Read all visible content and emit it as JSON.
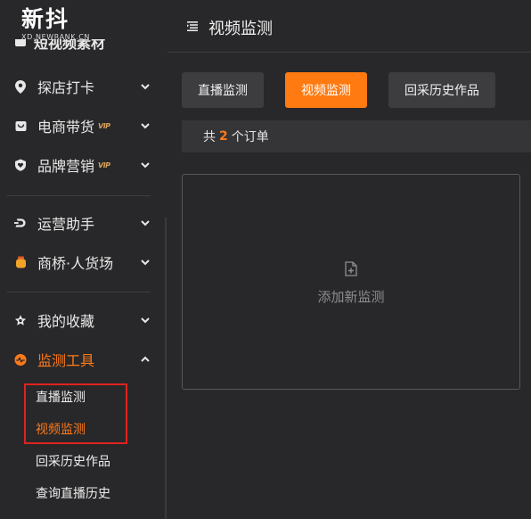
{
  "logo": {
    "main": "新抖",
    "sub": "XD.NEWRANK.CN"
  },
  "sidebar": {
    "cut_label": "短视频素材",
    "items": [
      {
        "label": "探店打卡",
        "icon": "location-pin-icon",
        "vip": ""
      },
      {
        "label": "电商带货",
        "icon": "shopping-bag-icon",
        "vip": "VIP"
      },
      {
        "label": "品牌营销",
        "icon": "heart-shield-icon",
        "vip": "VIP"
      },
      {
        "label": "运营助手",
        "icon": "d-logo-icon",
        "vip": ""
      },
      {
        "label": "商桥·人货场",
        "icon": "honey-jar-icon",
        "vip": ""
      },
      {
        "label": "我的收藏",
        "icon": "star-badge-icon",
        "vip": ""
      },
      {
        "label": "监测工具",
        "icon": "pulse-monitor-icon",
        "vip": ""
      }
    ],
    "sub_items": [
      {
        "label": "直播监测"
      },
      {
        "label": "视频监测"
      },
      {
        "label": "回采历史作品"
      },
      {
        "label": "查询直播历史"
      }
    ]
  },
  "header": {
    "title": "视频监测",
    "icon": "list-menu-icon"
  },
  "tabs": [
    {
      "label": "直播监测"
    },
    {
      "label": "视频监测"
    },
    {
      "label": "回采历史作品"
    }
  ],
  "order_bar": {
    "prefix": "共",
    "count": "2",
    "suffix": "个订单"
  },
  "add_card": {
    "label": "添加新监测",
    "icon": "add-file-icon"
  },
  "colors": {
    "accent": "#ff7a10",
    "background": "#28282a",
    "highlight_box": "#e0221e"
  }
}
